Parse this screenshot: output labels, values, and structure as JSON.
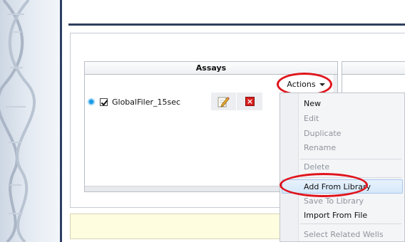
{
  "assays_panel": {
    "title": "Assays",
    "actions_label": "Actions",
    "rows": [
      {
        "name": "GlobalFiler_15sec",
        "selected": true,
        "checked": true
      }
    ]
  },
  "actions_menu": {
    "items": [
      {
        "label": "New",
        "enabled": true
      },
      {
        "label": "Edit",
        "enabled": false
      },
      {
        "label": "Duplicate",
        "enabled": false
      },
      {
        "label": "Rename",
        "enabled": false
      },
      {
        "label": "Delete",
        "enabled": false
      },
      {
        "label": "Add From Library",
        "enabled": true,
        "highlighted": true
      },
      {
        "label": "Save To Library",
        "enabled": false
      },
      {
        "label": "Import From File",
        "enabled": true
      },
      {
        "label": "Select Related Wells",
        "enabled": false
      }
    ]
  },
  "colors": {
    "highlight_ellipse": "#e0141c",
    "nav_border": "#2d3e66",
    "radio_selected": "#1b9be6"
  },
  "icons": [
    "edit-pencil-icon",
    "delete-x-icon",
    "dropdown-caret-icon"
  ]
}
